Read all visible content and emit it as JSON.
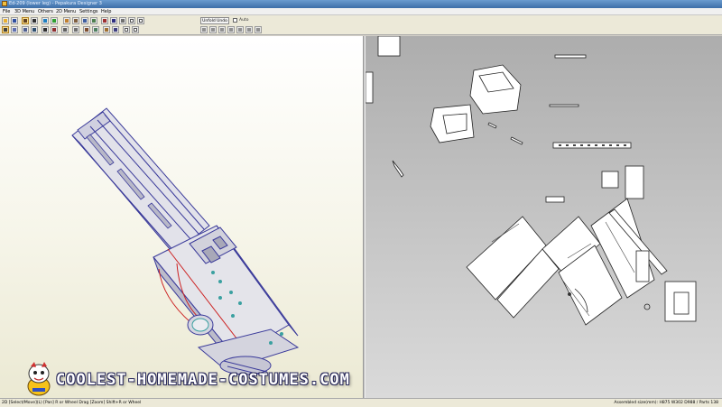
{
  "window": {
    "title": "Ed-209 (lower leg) - Pepakura Designer 3"
  },
  "menu": {
    "items": [
      "File",
      "3D Menu",
      "Others",
      "2D Menu",
      "Settings",
      "Help"
    ]
  },
  "toolbar": {
    "left_icons": [
      "open-icon",
      "save-icon",
      "select-tool-icon",
      "paint-icon",
      "color-icon",
      "rotate-icon",
      "zoom-icon",
      "edit-icon",
      "fold-icon",
      "join-icon",
      "cut-icon",
      "text-icon",
      "move-icon",
      "flap-icon",
      "scale-icon",
      "grid-icon",
      "window-icon",
      "window2-icon"
    ],
    "unfold_label": "Unfold Undo",
    "auto_label": "Auto"
  },
  "status": {
    "left": "2D [Select/Move](L) [Pan] R or Wheel Drag [Zoom] Shift+R or Wheel",
    "right": "Assembled size(mm): H875 W302 D988 / Parts 138"
  },
  "watermark": {
    "text": "COOLEST-HOMEMADE-COSTUMES.COM"
  },
  "colors": {
    "model_outline": "#3a3a9a",
    "model_fill": "#d8d8de",
    "fold_red": "#cc2020",
    "fold_teal": "#3aa0a0"
  }
}
